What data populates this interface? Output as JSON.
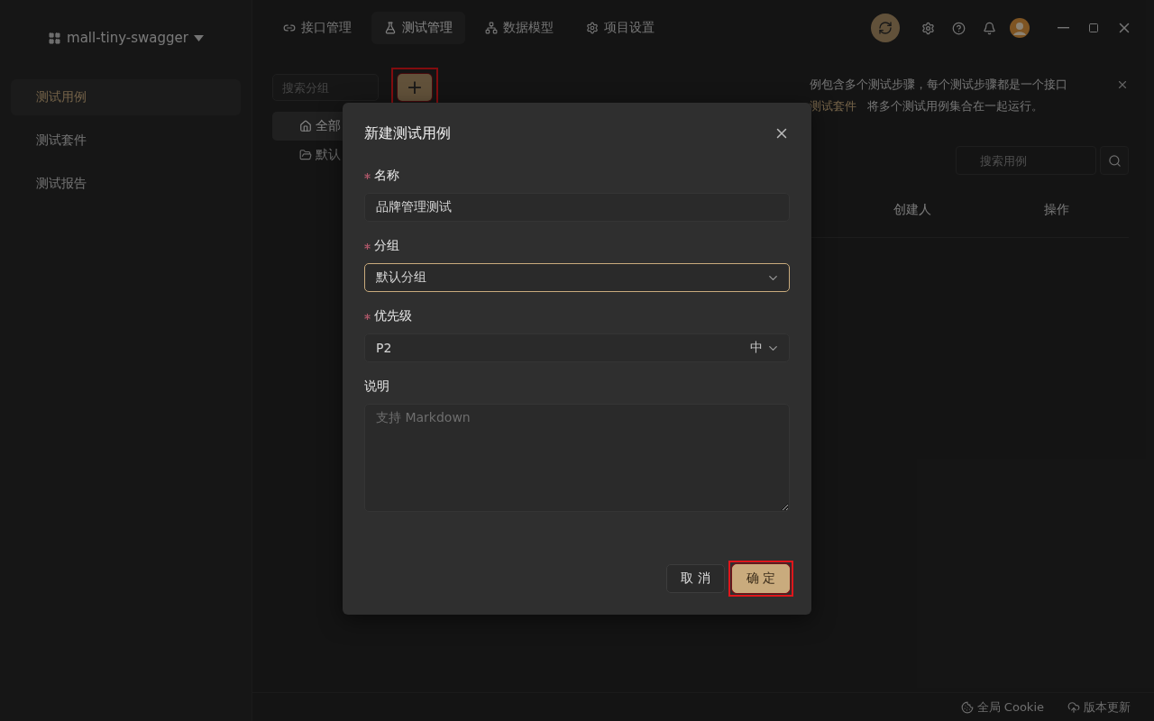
{
  "project": {
    "name": "mall-tiny-swagger"
  },
  "nav_tabs": [
    {
      "label": "接口管理",
      "selected": false
    },
    {
      "label": "测试管理",
      "selected": true
    },
    {
      "label": "数据模型",
      "selected": false
    },
    {
      "label": "项目设置",
      "selected": false
    }
  ],
  "sidebar": {
    "items": [
      {
        "label": "测试用例",
        "selected": true
      },
      {
        "label": "测试套件",
        "selected": false
      },
      {
        "label": "测试报告",
        "selected": false
      }
    ]
  },
  "groups": {
    "search_placeholder": "搜索分组",
    "add_button": {
      "label": "+",
      "highlighted": true
    },
    "tree": [
      {
        "label": "全部",
        "selected": true
      },
      {
        "label": "默认",
        "selected": false
      }
    ]
  },
  "banner": {
    "line_1": "例包含多个测试步骤，每个测试步骤都是一个接口",
    "link": "测试套件",
    "line_2_rest": "将多个测试用例集合在一起运行。"
  },
  "case_search": {
    "placeholder": "搜索用例"
  },
  "table": {
    "columns": [
      "创建人",
      "操作"
    ]
  },
  "dialog": {
    "title": "新建测试用例",
    "fields": [
      {
        "kind": "text",
        "label": "名称",
        "required": true,
        "value": "品牌管理测试",
        "focused": false
      },
      {
        "kind": "select",
        "label": "分组",
        "required": true,
        "value": "默认分组",
        "focused": true
      },
      {
        "kind": "select",
        "label": "优先级",
        "required": true,
        "value": "P2",
        "suffix": "中",
        "focused": false
      },
      {
        "kind": "textarea",
        "label": "说明",
        "required": false,
        "placeholder": "支持 Markdown",
        "focused": false
      }
    ],
    "buttons": [
      {
        "label": "取 消",
        "primary": false,
        "highlighted": false
      },
      {
        "label": "确 定",
        "primary": true,
        "highlighted": true
      }
    ]
  },
  "status_bar": {
    "items": [
      {
        "label": "全局 Cookie"
      },
      {
        "label": "版本更新"
      }
    ]
  }
}
